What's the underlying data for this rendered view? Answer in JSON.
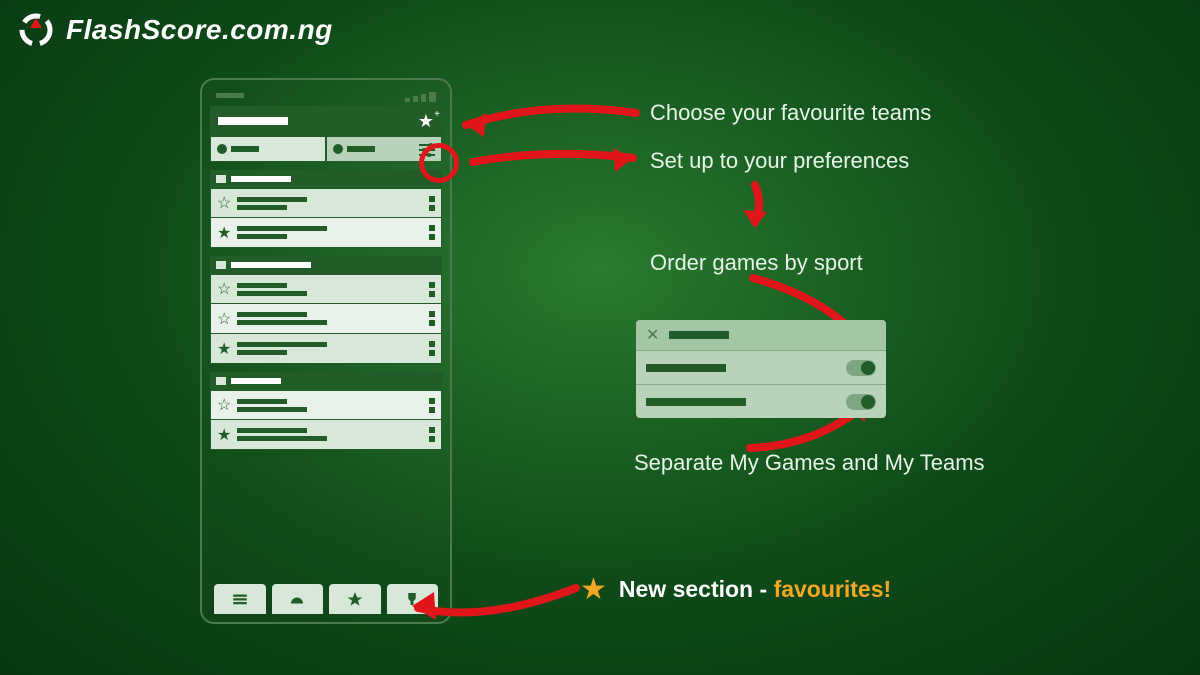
{
  "logo_text": "FlashScore.com.ng",
  "callouts": {
    "favourite_teams": "Choose your favourite teams",
    "preferences": "Set up to your preferences",
    "order_by_sport": "Order games by sport",
    "separate": "Separate My Games and My Teams"
  },
  "new_section": {
    "prefix": "New section - ",
    "highlight": "favourites!"
  }
}
